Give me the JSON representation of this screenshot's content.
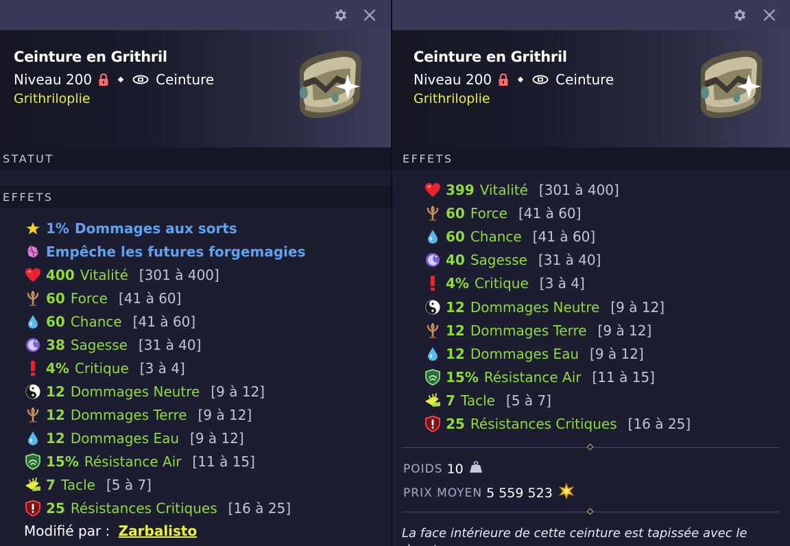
{
  "colors": {
    "effect_green": "#8fdb3a",
    "effect_blue": "#5ea3f2",
    "set_yellow": "#e7f03c",
    "range_gray": "#c4c6d4",
    "panel_bg": "#1c1d30"
  },
  "left_panel": {
    "icons": {
      "settings": "gear-icon",
      "close": "close-icon"
    },
    "title": "Ceinture en Grithril",
    "level": "Niveau 200",
    "type": "Ceinture",
    "set": "Grithriloplie",
    "sections": {
      "status": "STATUT",
      "effects": "EFFETS"
    },
    "effects": [
      {
        "icon": "star-icon",
        "value": "1%",
        "name": "Dommages aux sorts",
        "range": "",
        "style": "blue"
      },
      {
        "icon": "crystal-icon",
        "value": "",
        "name": "Empêche les futures forgemagies",
        "range": "",
        "style": "blue"
      },
      {
        "icon": "heart-icon",
        "value": "400",
        "name": "Vitalité",
        "range": "[301 à 400]",
        "style": "green"
      },
      {
        "icon": "earth-icon",
        "value": "60",
        "name": "Force",
        "range": "[41 à 60]",
        "style": "green"
      },
      {
        "icon": "water-drop-icon",
        "value": "60",
        "name": "Chance",
        "range": "[41 à 60]",
        "style": "green"
      },
      {
        "icon": "wisdom-moon-icon",
        "value": "38",
        "name": "Sagesse",
        "range": "[31 à 40]",
        "style": "green"
      },
      {
        "icon": "exclamation-icon",
        "value": "4%",
        "name": "Critique",
        "range": "[3 à 4]",
        "style": "green"
      },
      {
        "icon": "yin-yang-icon",
        "value": "12",
        "name": "Dommages Neutre",
        "range": "[9 à 12]",
        "style": "green"
      },
      {
        "icon": "earth-icon",
        "value": "12",
        "name": "Dommages Terre",
        "range": "[9 à 12]",
        "style": "green"
      },
      {
        "icon": "water-drop-icon",
        "value": "12",
        "name": "Dommages Eau",
        "range": "[9 à 12]",
        "style": "green"
      },
      {
        "icon": "air-shield-icon",
        "value": "15%",
        "name": "Résistance Air",
        "range": "[11 à 15]",
        "style": "green"
      },
      {
        "icon": "tackle-icon",
        "value": "7",
        "name": "Tacle",
        "range": "[5 à 7]",
        "style": "green"
      },
      {
        "icon": "crit-shield-icon",
        "value": "25",
        "name": "Résistances Critiques",
        "range": "[16 à 25]",
        "style": "green"
      }
    ],
    "modified_by_label": "Modifié par :",
    "modified_by_name": "Zarbalisto"
  },
  "right_panel": {
    "icons": {
      "settings": "gear-icon",
      "close": "close-icon"
    },
    "title": "Ceinture en Grithril",
    "level": "Niveau 200",
    "type": "Ceinture",
    "set": "Grithriloplie",
    "sections": {
      "effects": "EFFETS"
    },
    "effects": [
      {
        "icon": "heart-icon",
        "value": "399",
        "name": "Vitalité",
        "range": "[301 à 400]",
        "style": "green"
      },
      {
        "icon": "earth-icon",
        "value": "60",
        "name": "Force",
        "range": "[41 à 60]",
        "style": "green"
      },
      {
        "icon": "water-drop-icon",
        "value": "60",
        "name": "Chance",
        "range": "[41 à 60]",
        "style": "green"
      },
      {
        "icon": "wisdom-moon-icon",
        "value": "40",
        "name": "Sagesse",
        "range": "[31 à 40]",
        "style": "green"
      },
      {
        "icon": "exclamation-icon",
        "value": "4%",
        "name": "Critique",
        "range": "[3 à 4]",
        "style": "green"
      },
      {
        "icon": "yin-yang-icon",
        "value": "12",
        "name": "Dommages Neutre",
        "range": "[9 à 12]",
        "style": "green"
      },
      {
        "icon": "earth-icon",
        "value": "12",
        "name": "Dommages Terre",
        "range": "[9 à 12]",
        "style": "green"
      },
      {
        "icon": "water-drop-icon",
        "value": "12",
        "name": "Dommages Eau",
        "range": "[9 à 12]",
        "style": "green"
      },
      {
        "icon": "air-shield-icon",
        "value": "15%",
        "name": "Résistance Air",
        "range": "[11 à 15]",
        "style": "green"
      },
      {
        "icon": "tackle-icon",
        "value": "7",
        "name": "Tacle",
        "range": "[5 à 7]",
        "style": "green"
      },
      {
        "icon": "crit-shield-icon",
        "value": "25",
        "name": "Résistances Critiques",
        "range": "[16 à 25]",
        "style": "green"
      }
    ],
    "weight_label": "POIDS",
    "weight_value": "10",
    "price_label": "PRIX MOYEN",
    "price_value": "5 559 523",
    "price_icon": "kama-coin-icon",
    "weight_icon": "weight-icon",
    "description": "La face intérieure de cette ceinture est tapissée avec le duvet"
  }
}
